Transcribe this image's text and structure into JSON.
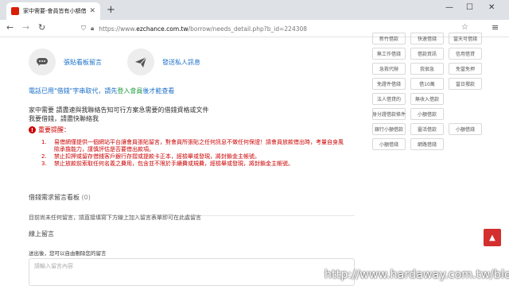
{
  "browser": {
    "tab_title": "家中需要-會員皆有小額借款刷卡...",
    "tab_close": "✕",
    "new_tab": "+",
    "win_min": "—",
    "win_max": "☐",
    "win_close": "✕",
    "url_prefix": "https://www.",
    "url_host": "ezchance.com.tw",
    "url_path": "/borrow/needs_detail.php?b_id=224308"
  },
  "actions": {
    "post_message": "張貼看板留言",
    "send_private": "發送私人訊息"
  },
  "notice": {
    "pre": "電話已用\"借錢\"字串取代，請先",
    "highlight": "登入會員",
    "post": "後才能查看"
  },
  "description": {
    "line1": "家中需要 請盡速與我聯絡告知可行方案急需要的借錢資格或文件",
    "line2": "我要借錢，請盡快聯絡我"
  },
  "important": {
    "title": "重要提醒：",
    "rules": [
      {
        "num": "1.",
        "text": "易借網僅提供一個網站平台讓會員張貼留言，對會員所張貼之任何訊息不做任何保證！請會員放款借出時，考量自身風險承擔能力，謹慎評估是否要借出款項。"
      },
      {
        "num": "2.",
        "text": "禁止扣押或留存借錢客戶銀行存摺或提款卡正本，經檢舉或發現，將封鎖金主帳號。"
      },
      {
        "num": "3.",
        "text": "禁止放款前索取任何名義之費用，包含並不限於手續費或規費，經檢舉或發現，將封鎖金主帳號。"
      }
    ]
  },
  "board": {
    "title": "借錢需求留言看板",
    "count": "(0)",
    "empty": "目前尚未任何留言，請直接填寫下方線上加入留言表單即可在此處留言",
    "online_title": "線上留言",
    "login_note": "送出後，您可以自由刪除您的留言",
    "placeholder": "請輸入留言內容"
  },
  "categories": [
    "新竹借款",
    "快速借錢",
    "當天可借錢",
    "無工作借錢",
    "借款資訊",
    "信用借貸",
    "急救代辦",
    "我很急",
    "免當免押",
    "免證件借錢",
    "借10萬",
    "當日撥款",
    "法人借貸的",
    "無收入借款",
    "",
    "身分證借款條件",
    "小額借款",
    "",
    "銀行小額借款",
    "靈活借款",
    "小額借錢",
    "小額借錢",
    "網路借錢",
    ""
  ],
  "totop_icon": "▲",
  "watermark": "http://www.hardaway.com.tw/blog",
  "colors": {
    "link_blue": "#1a6fc9",
    "accent_green": "#1a9a3a",
    "alert_red": "#cc0000",
    "totop_red": "#d32f2f"
  }
}
